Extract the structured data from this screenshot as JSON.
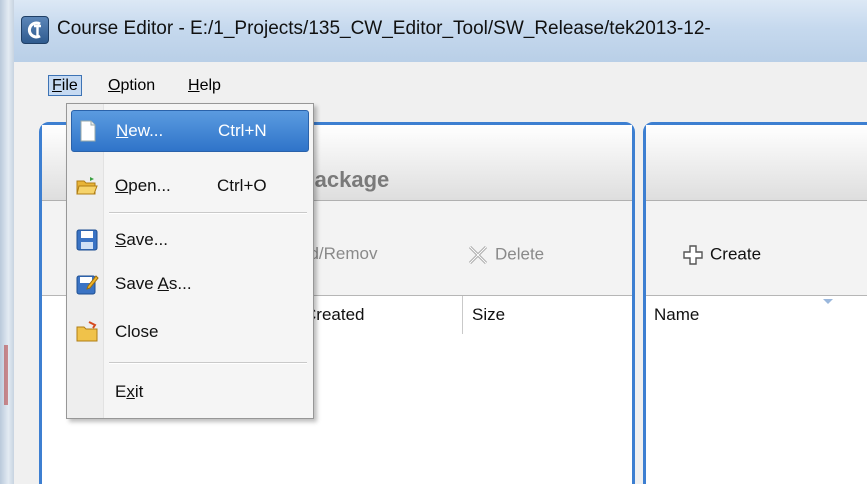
{
  "window": {
    "title": "Course Editor - E:/1_Projects/135_CW_Editor_Tool/SW_Release/tek2013-12-",
    "app_icon": "course-editor-app-icon"
  },
  "menubar": {
    "items": [
      {
        "label": "File",
        "mnemonic": "F",
        "rest": "ile",
        "active": true
      },
      {
        "label": "Option",
        "mnemonic": "O",
        "rest": "ption"
      },
      {
        "label": "Help",
        "mnemonic": "H",
        "rest": "elp"
      }
    ]
  },
  "file_menu": {
    "items": [
      {
        "id": "new",
        "pre": "",
        "mn": "N",
        "post": "ew...",
        "shortcut": "Ctrl+N",
        "icon": "new-document-icon",
        "highlighted": true
      },
      {
        "id": "open",
        "pre": "",
        "mn": "O",
        "post": "pen...",
        "shortcut": "Ctrl+O",
        "icon": "open-folder-icon"
      },
      {
        "id": "save",
        "pre": "",
        "mn": "S",
        "post": "ave...",
        "shortcut": "",
        "icon": "save-disk-icon"
      },
      {
        "id": "save_as",
        "pre": "Save ",
        "mn": "A",
        "post": "s...",
        "shortcut": "",
        "icon": "save-as-icon"
      },
      {
        "id": "close",
        "pre": "Close",
        "mn": "",
        "post": "",
        "shortcut": "",
        "icon": "close-folder-icon"
      },
      {
        "id": "exit",
        "pre": "E",
        "mn": "x",
        "post": "it",
        "shortcut": "",
        "icon": ""
      }
    ]
  },
  "left_panel": {
    "title": "Package",
    "toolbar": {
      "add_remove": "dd/Remov",
      "delete": "Delete"
    },
    "columns": [
      "Created",
      "Size"
    ]
  },
  "right_panel": {
    "toolbar": {
      "create": "Create"
    },
    "columns": [
      "Name"
    ]
  },
  "colors": {
    "accent": "#3d7fd1",
    "highlight": "#2f74c9"
  }
}
